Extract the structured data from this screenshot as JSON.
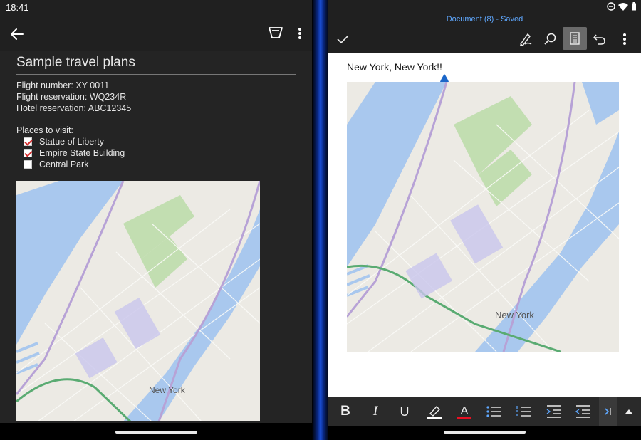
{
  "status": {
    "time": "18:41"
  },
  "left_pane": {
    "note": {
      "title": "Sample travel plans",
      "flight_number": "Flight number: XY 0011",
      "flight_reservation": "Flight reservation: WQ234R",
      "hotel_reservation": "Hotel reservation: ABC12345",
      "places_heading": "Places to visit:",
      "places": [
        {
          "label": "Statue of Liberty",
          "checked": true
        },
        {
          "label": "Empire State Building",
          "checked": true
        },
        {
          "label": "Central Park",
          "checked": false
        }
      ],
      "map": {
        "city_label": "New York"
      }
    },
    "icons": [
      "back-arrow-icon",
      "filter-icon",
      "more-vert-icon"
    ]
  },
  "right_pane": {
    "document_title": "Document (8) - Saved",
    "toolbar_icons": [
      "checkmark-icon",
      "draw-pen-icon",
      "search-icon",
      "reading-view-icon",
      "undo-icon",
      "more-vert-icon"
    ],
    "doc": {
      "heading": "New York, New York!!",
      "map": {
        "city_label": "New York"
      }
    },
    "format_bar": {
      "bold": "B",
      "italic": "I",
      "underline": "U",
      "highlight_color": "#ffffff",
      "font_color": "#e81123",
      "font_color_letter": "A"
    }
  },
  "colors": {
    "accent_blue": "#5fa8ff",
    "checkbox_mark": "#d42a2a",
    "map_water": "#a9c8ee",
    "map_park": "#c2deb1"
  }
}
